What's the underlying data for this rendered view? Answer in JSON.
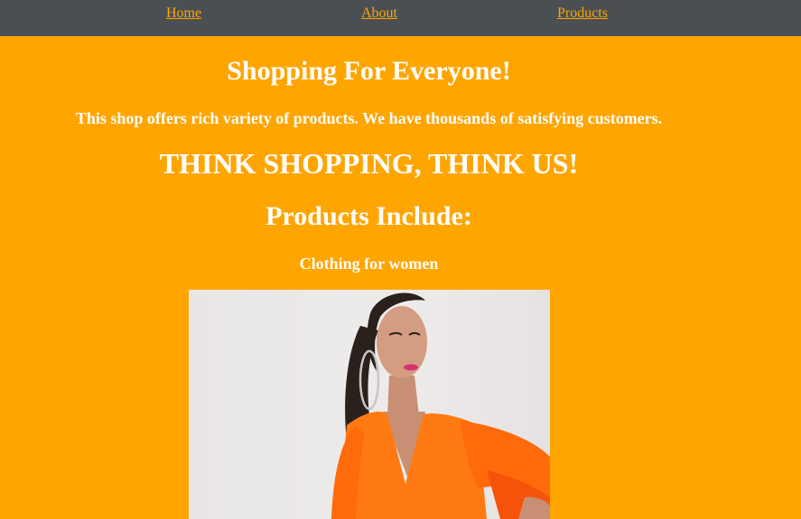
{
  "nav": {
    "items": [
      {
        "label": "Home"
      },
      {
        "label": "About"
      },
      {
        "label": "Products"
      }
    ]
  },
  "main": {
    "title": "Shopping For Everyone!",
    "subtitle": "This shop offers rich variety of products. We have thousands of satisfying customers.",
    "slogan": "THINK SHOPPING, THINK US!",
    "products_heading": "Products Include:",
    "category": "Clothing for women",
    "image_subject": "woman in orange ruffle-sleeve top"
  },
  "colors": {
    "page_background": "#ffa500",
    "navbar_background": "#4a4f54",
    "nav_link": "#ffa500",
    "heading_text": "#ffffff",
    "garment": "#ff7a12"
  }
}
